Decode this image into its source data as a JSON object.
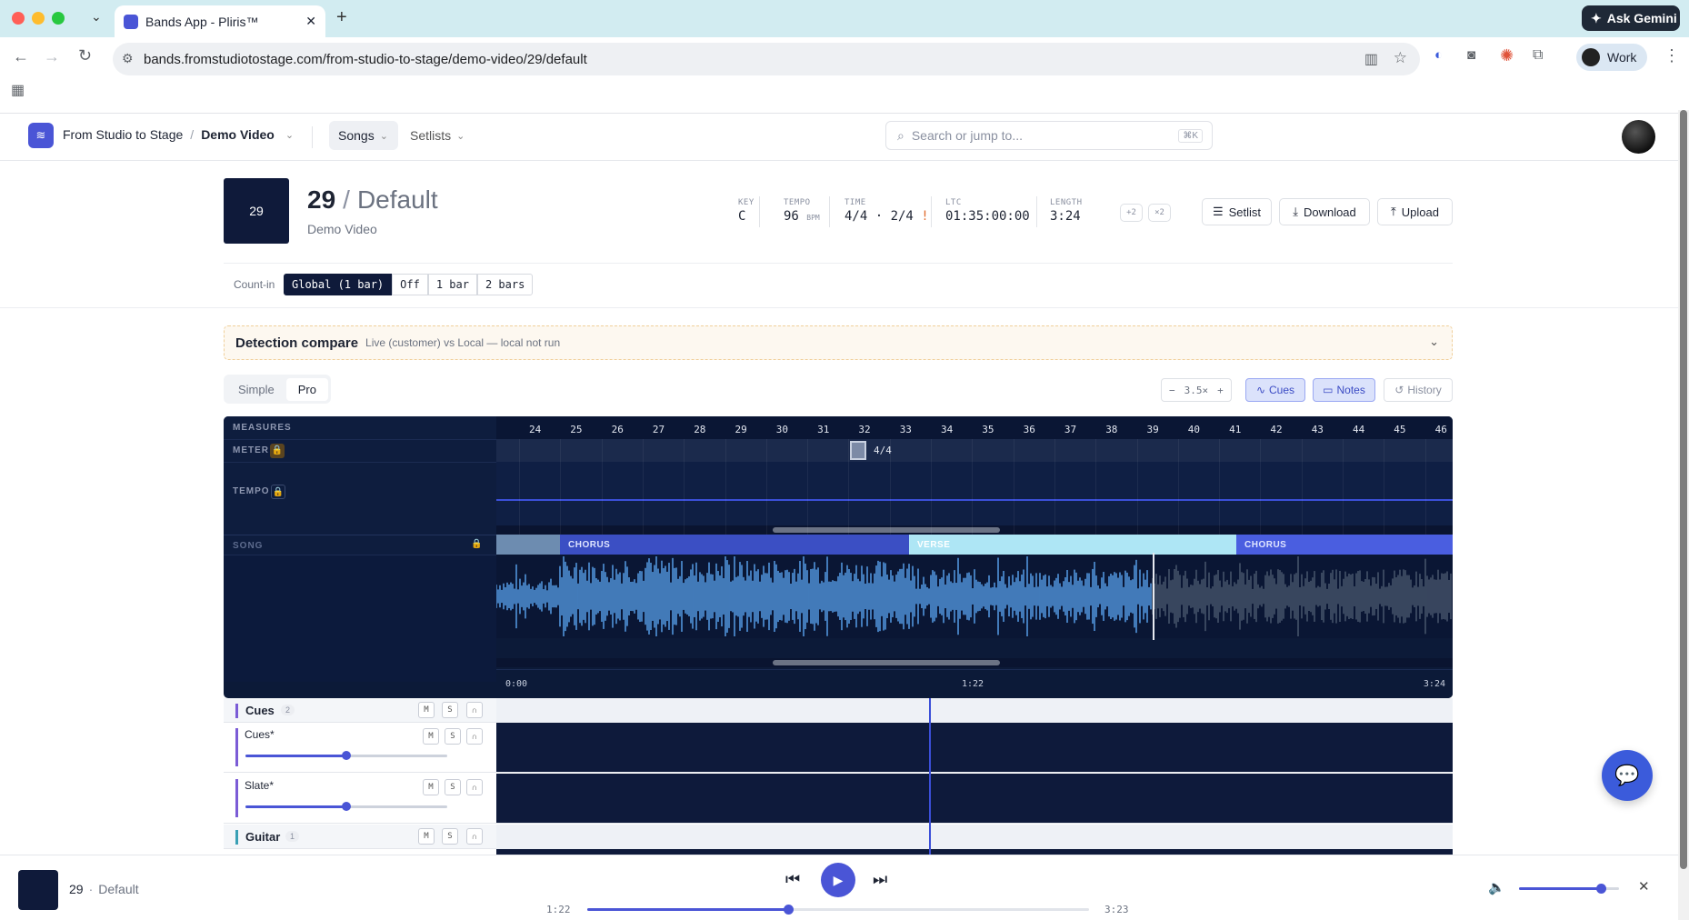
{
  "browser": {
    "tab_title": "Bands App - Pliris™",
    "url": "bands.fromstudiotostage.com/from-studio-to-stage/demo-video/29/default",
    "ask_gemini": "Ask Gemini",
    "profile": "Work"
  },
  "header": {
    "org": "From Studio to Stage",
    "separator": "/",
    "project": "Demo Video",
    "nav_songs": "Songs",
    "nav_setlists": "Setlists",
    "search_placeholder": "Search or jump to...",
    "search_shortcut": "⌘K"
  },
  "song": {
    "thumb_number": "29",
    "number": "29",
    "slash": "/",
    "name": "Default",
    "project": "Demo Video",
    "key_label": "KEY",
    "key": "C",
    "tempo_label": "TEMPO",
    "tempo": "96",
    "tempo_unit": "BPM",
    "time_label": "TIME",
    "time": "4/4 · 2/4",
    "time_warn": "!",
    "ltc_label": "LTC",
    "ltc": "01:35:00:00",
    "length_label": "LENGTH",
    "length": "3:24",
    "transpose_up": "+2",
    "transpose_mult": "×2",
    "btn_setlist": "Setlist",
    "btn_download": "Download",
    "btn_upload": "Upload"
  },
  "countin": {
    "label": "Count-in",
    "options": [
      "Global (1 bar)",
      "Off",
      "1 bar",
      "2 bars"
    ],
    "selected": 0
  },
  "detection": {
    "title": "Detection compare",
    "subtitle": "Live (customer) vs Local — local not run"
  },
  "mode": {
    "simple": "Simple",
    "pro": "Pro",
    "selected": "Pro"
  },
  "view_controls": {
    "zoom_minus": "−",
    "zoom": "3.5×",
    "zoom_plus": "+",
    "cues": "Cues",
    "notes": "Notes",
    "history": "History"
  },
  "timeline": {
    "measures_label": "MEASURES",
    "meter_label": "METER",
    "tempo_label": "TEMPO",
    "song_label": "SONG",
    "measures": [
      "24",
      "25",
      "26",
      "27",
      "28",
      "29",
      "30",
      "31",
      "32",
      "33",
      "34",
      "35",
      "36",
      "37",
      "38",
      "39",
      "40",
      "41",
      "42",
      "43",
      "44",
      "45",
      "46"
    ],
    "meter_marker": "4/4",
    "sections": [
      {
        "label": "",
        "color": "#6d8cb0"
      },
      {
        "label": "CHORUS",
        "color": "#3b4fc4"
      },
      {
        "label": "VERSE",
        "color": "#aee6f5"
      },
      {
        "label": "CHORUS",
        "color": "#4a5ee0"
      }
    ],
    "time_start": "0:00",
    "time_mid": "1:22",
    "time_end": "3:24"
  },
  "tracks": {
    "groups": [
      {
        "name": "Cues",
        "count": "2",
        "color": "#7b5cd6"
      },
      {
        "name": "Guitar",
        "count": "1",
        "color": "#3aa0b5"
      }
    ],
    "children": [
      {
        "name": "Cues*",
        "volume": 0.5
      },
      {
        "name": "Slate*",
        "volume": 0.5
      }
    ],
    "mute": "M",
    "solo": "S"
  },
  "player": {
    "song_number": "29",
    "dot": "·",
    "song_name": "Default",
    "elapsed": "1:22",
    "total": "3:23",
    "progress": 0.4,
    "volume": 0.82
  },
  "colors": {
    "accent": "#4a55d6",
    "panel_bg": "#0c1a38",
    "waveform_played": "#5aa6f2",
    "waveform_unplayed": "#4d5a70"
  },
  "icons": [
    "back-icon",
    "forward-icon",
    "reload-icon",
    "apps-icon",
    "search-icon",
    "setlist-icon",
    "download-icon",
    "upload-icon",
    "chevron-down-icon",
    "lock-icon",
    "headphones-icon",
    "prev-icon",
    "play-icon",
    "next-icon",
    "volume-icon",
    "close-icon",
    "chat-icon",
    "history-icon",
    "notes-icon",
    "cues-icon"
  ]
}
